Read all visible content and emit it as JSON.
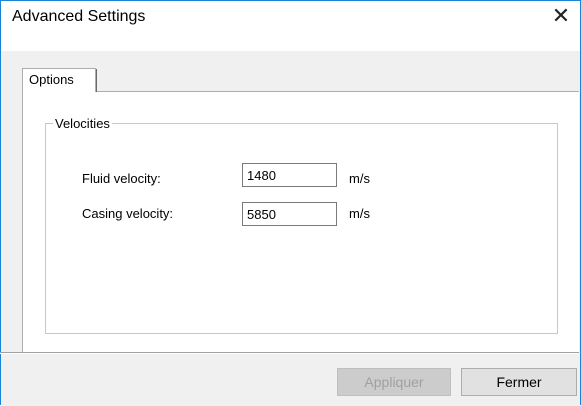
{
  "window": {
    "title": "Advanced Settings",
    "close_glyph": "✕"
  },
  "tabs": [
    {
      "label": "Options",
      "selected": true
    }
  ],
  "velocities": {
    "group_label": "Velocities",
    "fluid": {
      "label": "Fluid velocity:",
      "value": "1480",
      "unit": "m/s"
    },
    "casing": {
      "label": "Casing velocity:",
      "value": "5850",
      "unit": "m/s"
    }
  },
  "buttons": {
    "apply": "Appliquer",
    "close": "Fermer"
  },
  "colors": {
    "accent_border": "#1883d7",
    "dialog_bg": "#f0f0f0",
    "disabled_text": "#a0a0a0"
  }
}
